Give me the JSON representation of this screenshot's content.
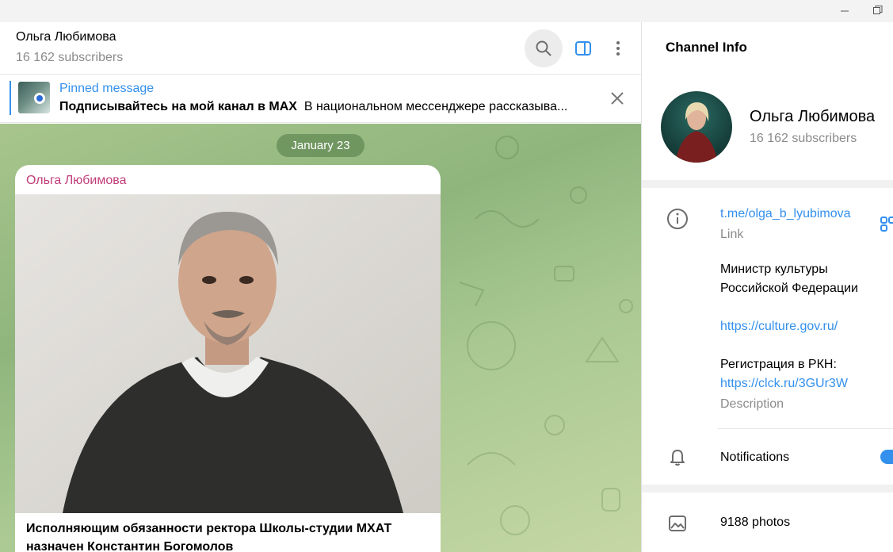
{
  "window": {
    "minimize_icon": "minimize-icon",
    "restore_icon": "restore-icon"
  },
  "chat": {
    "title": "Ольга Любимова",
    "subtitle": "16 162 subscribers",
    "pinned": {
      "label": "Pinned message",
      "title": "Подписывайтесь на мой канал в MAX",
      "preview": "В национальном мессенджере рассказыва..."
    },
    "date": "January 23",
    "message": {
      "author": "Ольга Любимова",
      "text": "Исполняющим обязанности ректора Школы-студии МХАТ назначен Константин Богомолов"
    }
  },
  "info": {
    "title": "Channel Info",
    "name": "Ольга Любимова",
    "subscribers": "16 162 subscribers",
    "link": "t.me/olga_b_lyubimova",
    "link_label": "Link",
    "description_line1": "Министр культуры",
    "description_line2": "Российской Федерации",
    "description_url": "https://culture.gov.ru/",
    "registration": "Регистрация в РКН:",
    "registration_url": "https://clck.ru/3GUr3W",
    "description_label": "Description",
    "notifications": "Notifications",
    "notifications_enabled": true,
    "photos": "9188 photos"
  },
  "colors": {
    "accent": "#3390ec",
    "author": "#c03d79",
    "chat_bg": "#a7c58c"
  }
}
